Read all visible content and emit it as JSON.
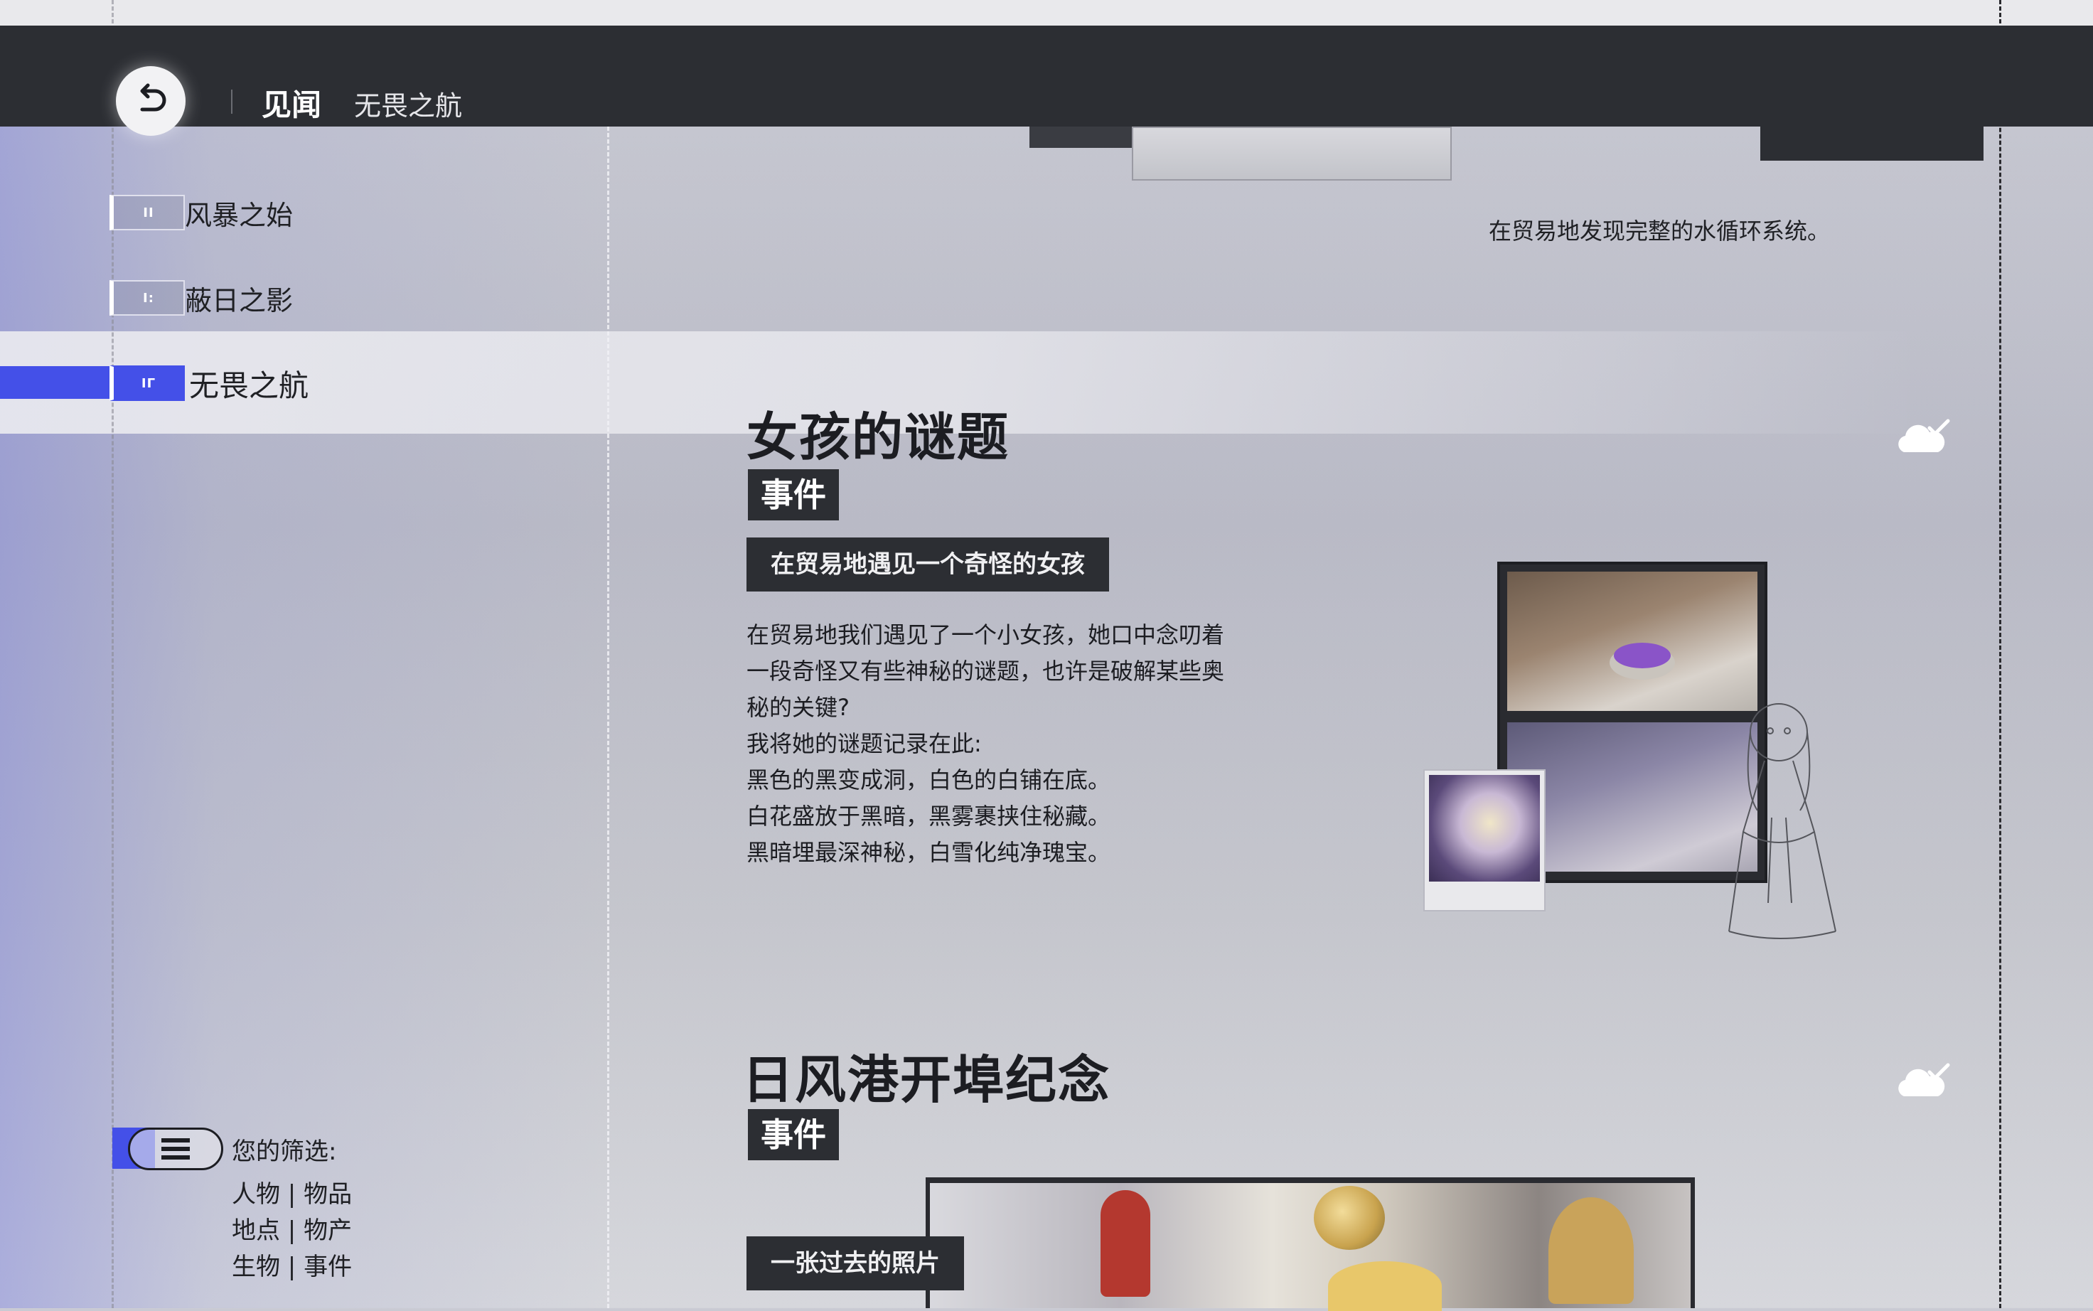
{
  "header": {
    "title": "见闻",
    "subtitle": "无畏之航",
    "back_icon": "back-arrow-icon"
  },
  "chapters": [
    {
      "code": "ⅠⅠ",
      "label": "风暴之始",
      "active": false
    },
    {
      "code": "Ⅰ:",
      "label": "蔽日之影",
      "active": false
    },
    {
      "code": "ⅠΓ",
      "label": "无畏之航",
      "active": true
    }
  ],
  "filter": {
    "label": "您的筛选:",
    "rows": [
      "人物 | 物品",
      "地点 | 物产",
      "生物 | 事件"
    ]
  },
  "previous_entry": {
    "description": "在贸易地发现完整的水循环系统。"
  },
  "entries": [
    {
      "title": "女孩的谜题",
      "tag": "事件",
      "subtitle": "在贸易地遇见一个奇怪的女孩",
      "body": [
        "在贸易地我们遇见了一个小女孩，她口中念叨着",
        "一段奇怪又有些神秘的谜题，也许是破解某些奥",
        "秘的关键?",
        "我将她的谜题记录在此:",
        "黑色的黑变成洞，白色的白铺在底。",
        "白花盛放于黑暗，黑雾裹挟住秘藏。",
        "黑暗埋最深神秘，白雪化纯净瑰宝。"
      ],
      "status_icon": "cloud-check-icon"
    },
    {
      "title": "日风港开埠纪念",
      "tag": "事件",
      "subtitle": "一张过去的照片",
      "status_icon": "cloud-check-icon"
    }
  ],
  "colors": {
    "accent": "#4450e8",
    "header_bg": "#2c2e33",
    "tag_bg": "#2c2e33"
  }
}
